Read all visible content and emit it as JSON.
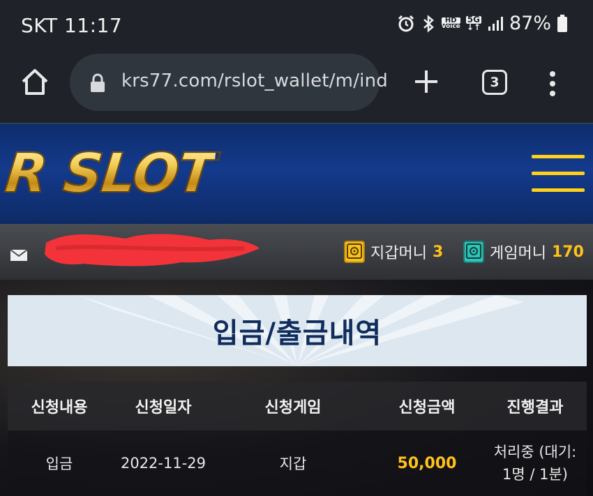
{
  "status_bar": {
    "carrier_time": "SKT 11:17",
    "battery": "87%",
    "icons": [
      "alarm-icon",
      "bluetooth-icon",
      "hd-voice-icon",
      "5g-icon",
      "signal-icon",
      "battery-icon"
    ],
    "hd_label": "HD",
    "voice_label": "Voice",
    "fiveg_label": "5G"
  },
  "browser": {
    "url": "krs77.com/rslot_wallet/m/ind",
    "tab_count": "3"
  },
  "site": {
    "logo": "R SLOT",
    "wallet_label": "지갑머니",
    "wallet_value": "3",
    "game_label": "게임머니",
    "game_value": "170"
  },
  "page": {
    "title": "입금/출금내역"
  },
  "table": {
    "headers": [
      "신청내용",
      "신청일자",
      "신청게임",
      "신청금액",
      "진행결과"
    ],
    "rows": [
      {
        "type": "입금",
        "date": "2022-11-29",
        "game": "지갑",
        "amount": "50,000",
        "result_line1": "처리중 (대기:",
        "result_line2": "1명 / 1분)"
      }
    ]
  },
  "colors": {
    "accent_gold": "#ffc21a",
    "header_blue": "#143a8c",
    "title_navy": "#0f2c5c"
  }
}
